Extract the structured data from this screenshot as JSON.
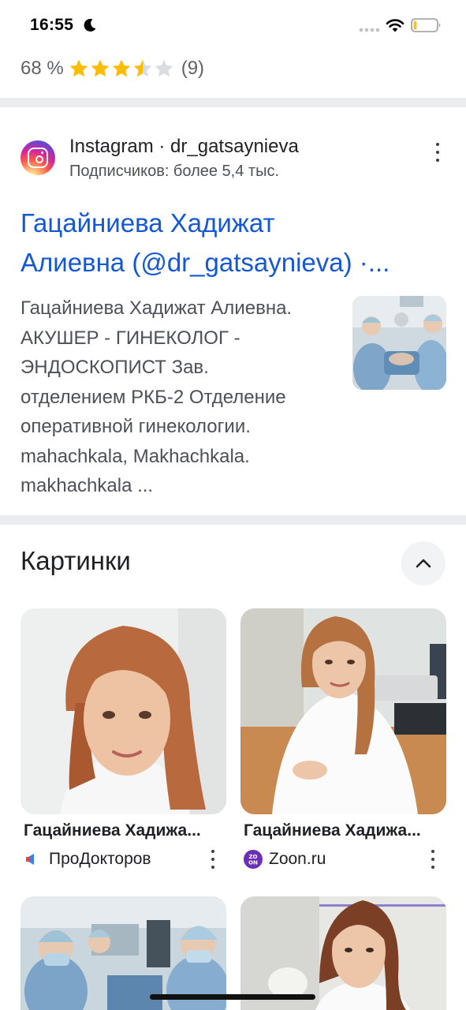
{
  "status_bar": {
    "time": "16:55",
    "icons": [
      "moon-icon",
      "signal-icon",
      "wifi-icon",
      "battery-icon"
    ]
  },
  "rating": {
    "percent_text": "68 %",
    "stars_value": 3.5,
    "stars_max": 5,
    "count_text": "(9)",
    "star_color": "#fbbc04",
    "star_empty_color": "#dadce0"
  },
  "instagram_result": {
    "source_name": "Instagram · dr_gatsaynieva",
    "source_subtitle": "Подписчиков: более 5,4 тыс.",
    "title_lines": [
      "Гацайниева Хадижат",
      "Алиевна (@dr_gatsaynieva) ·..."
    ],
    "snippet_lines": [
      "Гацайниева Хадижат Алиевна.",
      "АКУШЕР - ГИНЕКОЛОГ -",
      "ЭНДОСКОПИСТ Зав.",
      "отделением РКБ-2 Отделение",
      "оперативной гинекологии.",
      "mahachkala, Makhachkala.",
      "makhachkala ..."
    ],
    "link_color": "#1558d6"
  },
  "images_section": {
    "title": "Картинки",
    "cards": [
      {
        "title": "Гацайниева Хадижа...",
        "source": "ПроДокторов",
        "source_icon": "prodoctorov-icon"
      },
      {
        "title": "Гацайниева Хадижа...",
        "source": "Zoon.ru",
        "source_icon": "zoon-icon"
      }
    ]
  }
}
